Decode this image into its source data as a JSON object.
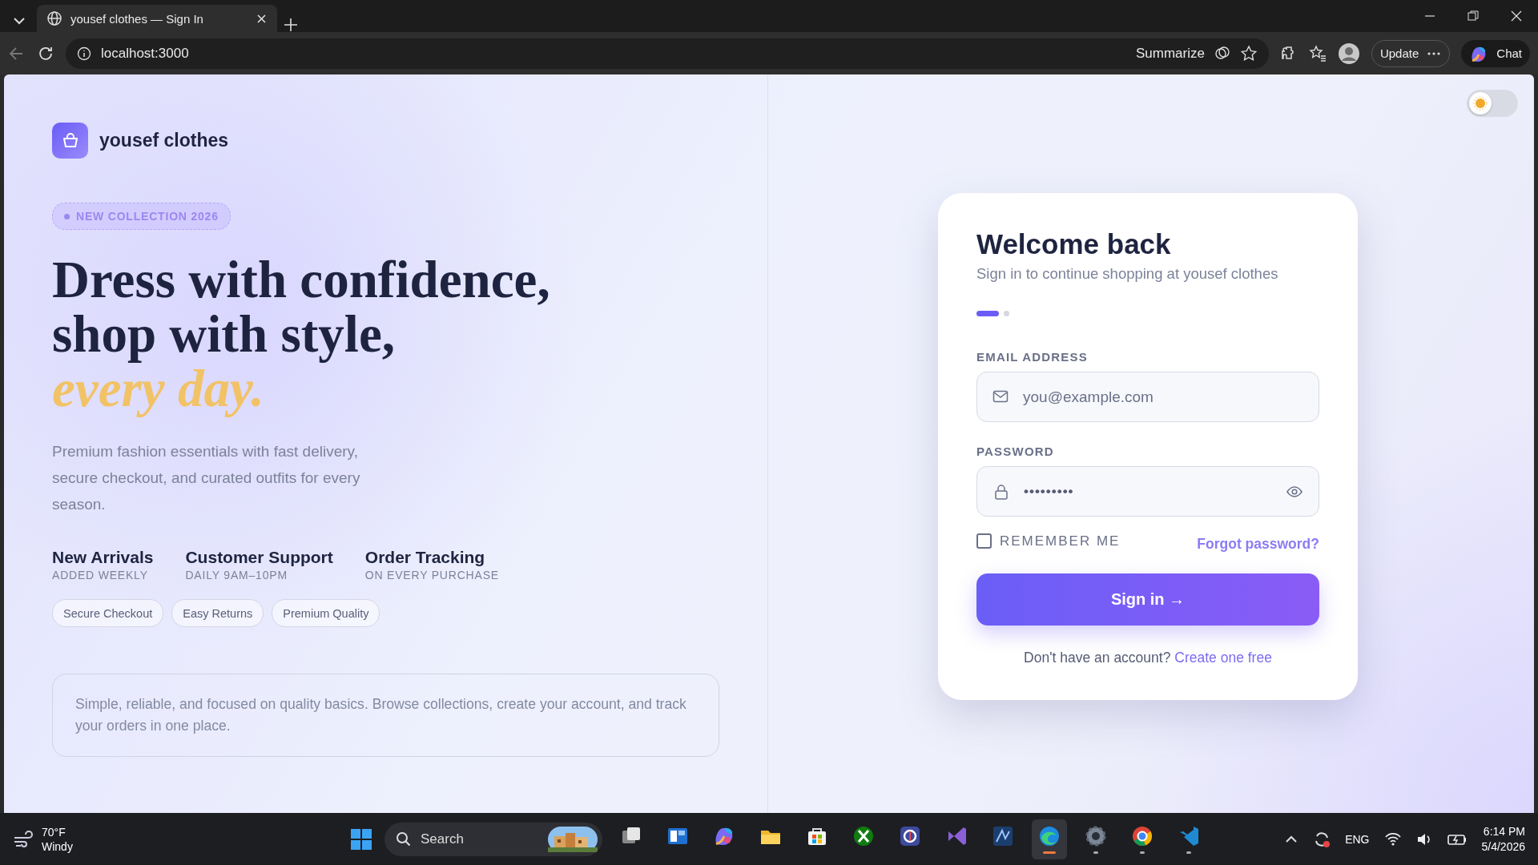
{
  "browser": {
    "tab_title": "yousef clothes — Sign In",
    "address": "localhost:3000",
    "summarize": "Summarize",
    "update": "Update",
    "chat": "Chat"
  },
  "theme_toggle": {
    "dark": false
  },
  "hero": {
    "brand": "yousef clothes",
    "badge": "NEW COLLECTION 2026",
    "headline": [
      {
        "text": "Dress with confidence,",
        "kind": "plain"
      },
      {
        "text": "shop with style,",
        "kind": "plain"
      },
      {
        "text": "every day.",
        "kind": "accent"
      }
    ],
    "description": "Premium fashion essentials with fast delivery, secure checkout, and curated outfits for every season.",
    "stats": [
      {
        "title": "New Arrivals",
        "subtitle": "ADDED WEEKLY"
      },
      {
        "title": "Customer Support",
        "subtitle": "DAILY 9AM–10PM"
      },
      {
        "title": "Order Tracking",
        "subtitle": "ON EVERY PURCHASE"
      }
    ],
    "chips": [
      "Secure Checkout",
      "Easy Returns",
      "Premium Quality"
    ],
    "note": "Simple, reliable, and focused on quality basics. Browse collections, create your account, and track your orders in one place."
  },
  "card": {
    "title": "Welcome back",
    "subtitle": "Sign in to continue shopping at yousef clothes",
    "steps": [
      {
        "selected": true
      },
      {
        "selected": false
      }
    ],
    "email": {
      "label": "EMAIL ADDRESS",
      "placeholder": "you@example.com"
    },
    "password": {
      "label": "PASSWORD",
      "value": "•••••••••"
    },
    "remember": {
      "label": "REMEMBER ME",
      "checked": false
    },
    "forgot": "Forgot password?",
    "submit": "Sign in →",
    "footer_prompt": "Don't have an account?",
    "footer_link": "Create one free"
  },
  "taskbar": {
    "weather": {
      "temperature": "70°F",
      "condition": "Windy"
    },
    "search": {
      "placeholder": "Search"
    },
    "apps": [
      {
        "kind": "stack",
        "running": false,
        "active": false
      },
      {
        "kind": "panel",
        "running": false,
        "active": false
      },
      {
        "kind": "swirl",
        "running": false,
        "active": false
      },
      {
        "kind": "folder",
        "running": false,
        "active": false
      },
      {
        "kind": "store",
        "running": false,
        "active": false
      },
      {
        "kind": "game",
        "running": false,
        "active": false
      },
      {
        "kind": "shield",
        "running": false,
        "active": false
      },
      {
        "kind": "ribbon",
        "running": false,
        "active": false
      },
      {
        "kind": "tile",
        "running": false,
        "active": false
      },
      {
        "kind": "wave",
        "running": true,
        "active": true
      },
      {
        "kind": "gear",
        "running": true,
        "active": false
      },
      {
        "kind": "ring",
        "running": true,
        "active": false
      },
      {
        "kind": "code",
        "running": true,
        "active": false
      }
    ],
    "language": "ENG",
    "time": "6:14 PM",
    "date": "5/4/2026"
  }
}
